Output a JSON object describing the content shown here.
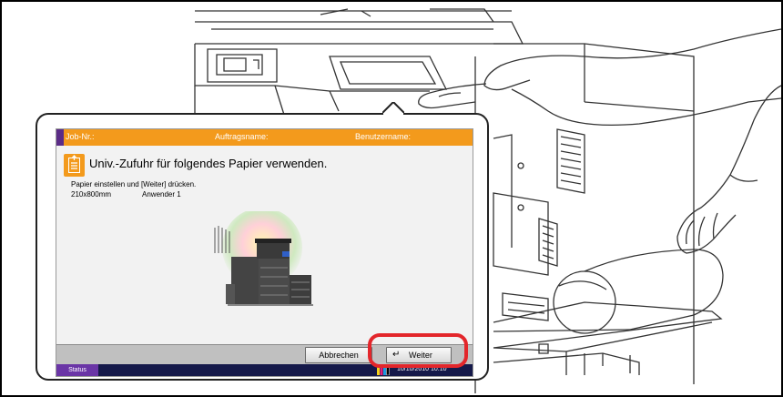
{
  "header": {
    "job_no": "Job-Nr.:",
    "job_name": "Auftragsname:",
    "user_name": "Benutzername:"
  },
  "message": {
    "title": "Univ.-Zufuhr für folgendes Papier verwenden.",
    "instruction": "Papier einstellen und [Weiter] drücken.",
    "paper_size": "210x800mm",
    "paper_type": "Anwender 1"
  },
  "buttons": {
    "cancel": "Abbrechen",
    "next": "Weiter"
  },
  "statusbar": {
    "status_label": "Status",
    "datetime": "10/10/2010  10:10"
  },
  "icons": {
    "message": "paper-document-icon",
    "next_arrow": "return-arrow-icon",
    "toner": "toner-bars-icon"
  },
  "colors": {
    "header_orange": "#f39a1c",
    "status_purple": "#6a35a6",
    "statusbar_navy": "#15194a",
    "highlight_red": "#e3262b"
  }
}
